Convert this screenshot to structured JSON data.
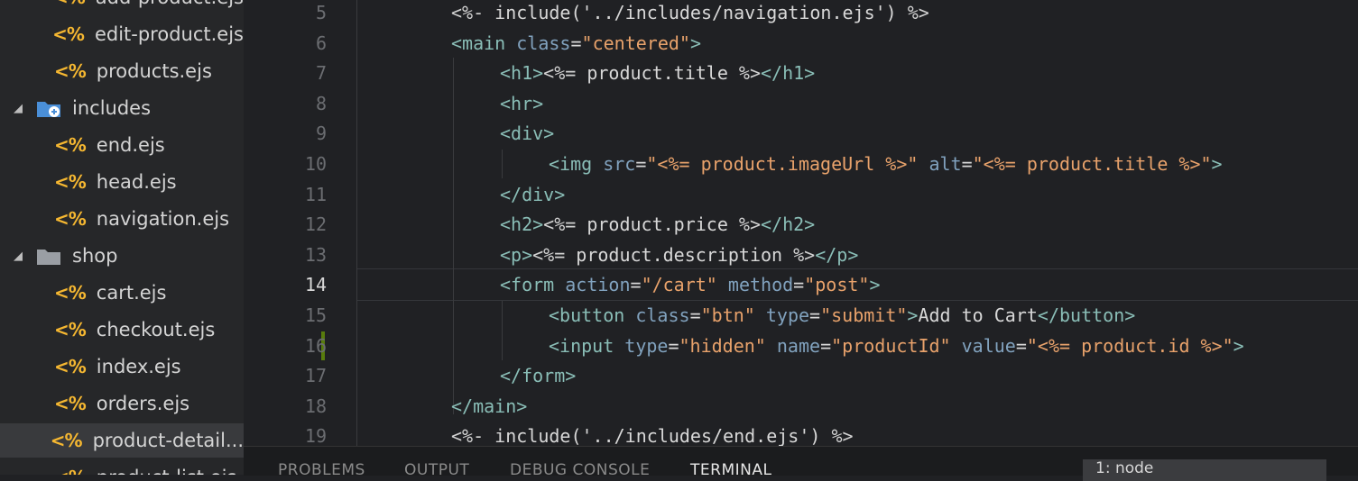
{
  "sidebar": {
    "items": [
      {
        "label": "add-product.ejs",
        "kind": "ejs",
        "indent": 2
      },
      {
        "label": "edit-product.ejs",
        "kind": "ejs",
        "indent": 2
      },
      {
        "label": "products.ejs",
        "kind": "ejs",
        "indent": 2
      },
      {
        "label": "includes",
        "kind": "folder-special",
        "indent": 1
      },
      {
        "label": "end.ejs",
        "kind": "ejs",
        "indent": 2
      },
      {
        "label": "head.ejs",
        "kind": "ejs",
        "indent": 2
      },
      {
        "label": "navigation.ejs",
        "kind": "ejs",
        "indent": 2
      },
      {
        "label": "shop",
        "kind": "folder",
        "indent": 1
      },
      {
        "label": "cart.ejs",
        "kind": "ejs",
        "indent": 2
      },
      {
        "label": "checkout.ejs",
        "kind": "ejs",
        "indent": 2
      },
      {
        "label": "index.ejs",
        "kind": "ejs",
        "indent": 2
      },
      {
        "label": "orders.ejs",
        "kind": "ejs",
        "indent": 2
      },
      {
        "label": "product-detail...",
        "kind": "ejs",
        "indent": 2,
        "selected": true
      },
      {
        "label": "product-list.ejs",
        "kind": "ejs",
        "indent": 2
      }
    ],
    "ejs_glyph": "<%"
  },
  "editor": {
    "active_line": 14,
    "lines": [
      {
        "n": 5,
        "indent": 0,
        "tokens": [
          [
            "del",
            "<%- "
          ],
          [
            "plain",
            "include('../includes/navigation.ejs') "
          ],
          [
            "del",
            "%>"
          ]
        ]
      },
      {
        "n": 6,
        "indent": 0,
        "tokens": [
          [
            "tag",
            "<main"
          ],
          [
            "plain",
            " "
          ],
          [
            "attr",
            "class"
          ],
          [
            "plain",
            "="
          ],
          [
            "str",
            "\"centered\""
          ],
          [
            "tag",
            ">"
          ]
        ]
      },
      {
        "n": 7,
        "indent": 1,
        "tokens": [
          [
            "tag",
            "<h1>"
          ],
          [
            "del",
            "<%= "
          ],
          [
            "plain",
            "product.title "
          ],
          [
            "del",
            "%>"
          ],
          [
            "tag",
            "</h1>"
          ]
        ]
      },
      {
        "n": 8,
        "indent": 1,
        "tokens": [
          [
            "tag",
            "<hr>"
          ]
        ]
      },
      {
        "n": 9,
        "indent": 1,
        "tokens": [
          [
            "tag",
            "<div>"
          ]
        ]
      },
      {
        "n": 10,
        "indent": 2,
        "tokens": [
          [
            "tag",
            "<img"
          ],
          [
            "plain",
            " "
          ],
          [
            "attr",
            "src"
          ],
          [
            "plain",
            "="
          ],
          [
            "str",
            "\"<%= product.imageUrl %>\""
          ],
          [
            "plain",
            " "
          ],
          [
            "attr",
            "alt"
          ],
          [
            "plain",
            "="
          ],
          [
            "str",
            "\"<%= product.title %>\""
          ],
          [
            "tag",
            ">"
          ]
        ]
      },
      {
        "n": 11,
        "indent": 1,
        "tokens": [
          [
            "tag",
            "</div>"
          ]
        ]
      },
      {
        "n": 12,
        "indent": 1,
        "tokens": [
          [
            "tag",
            "<h2>"
          ],
          [
            "del",
            "<%= "
          ],
          [
            "plain",
            "product.price "
          ],
          [
            "del",
            "%>"
          ],
          [
            "tag",
            "</h2>"
          ]
        ]
      },
      {
        "n": 13,
        "indent": 1,
        "tokens": [
          [
            "tag",
            "<p>"
          ],
          [
            "del",
            "<%= "
          ],
          [
            "plain",
            "product.description "
          ],
          [
            "del",
            "%>"
          ],
          [
            "tag",
            "</p>"
          ]
        ]
      },
      {
        "n": 14,
        "indent": 1,
        "tokens": [
          [
            "tag",
            "<form"
          ],
          [
            "plain",
            " "
          ],
          [
            "attr",
            "action"
          ],
          [
            "plain",
            "="
          ],
          [
            "str",
            "\"/cart\""
          ],
          [
            "plain",
            " "
          ],
          [
            "attr",
            "method"
          ],
          [
            "plain",
            "="
          ],
          [
            "str",
            "\"post\""
          ],
          [
            "tag",
            ">"
          ]
        ]
      },
      {
        "n": 15,
        "indent": 2,
        "tokens": [
          [
            "tag",
            "<button"
          ],
          [
            "plain",
            " "
          ],
          [
            "attr",
            "class"
          ],
          [
            "plain",
            "="
          ],
          [
            "str",
            "\"btn\""
          ],
          [
            "plain",
            " "
          ],
          [
            "attr",
            "type"
          ],
          [
            "plain",
            "="
          ],
          [
            "str",
            "\"submit\""
          ],
          [
            "tag",
            ">"
          ],
          [
            "plain",
            "Add to Cart"
          ],
          [
            "tag",
            "</button>"
          ]
        ]
      },
      {
        "n": 16,
        "indent": 2,
        "tokens": [
          [
            "tag",
            "<input"
          ],
          [
            "plain",
            " "
          ],
          [
            "attr",
            "type"
          ],
          [
            "plain",
            "="
          ],
          [
            "str",
            "\"hidden\""
          ],
          [
            "plain",
            " "
          ],
          [
            "attr",
            "name"
          ],
          [
            "plain",
            "="
          ],
          [
            "str",
            "\"productId\""
          ],
          [
            "plain",
            " "
          ],
          [
            "attr",
            "value"
          ],
          [
            "plain",
            "="
          ],
          [
            "str",
            "\"<%= product.id %>\""
          ],
          [
            "tag",
            ">"
          ]
        ]
      },
      {
        "n": 17,
        "indent": 1,
        "tokens": [
          [
            "tag",
            "</form>"
          ]
        ]
      },
      {
        "n": 18,
        "indent": 0,
        "tokens": [
          [
            "tag",
            "</main>"
          ]
        ]
      },
      {
        "n": 19,
        "indent": 0,
        "tokens": [
          [
            "del",
            "<%- "
          ],
          [
            "plain",
            "include('../includes/end.ejs') "
          ],
          [
            "del",
            "%>"
          ]
        ]
      }
    ],
    "colors": {
      "tag": "#8abeb7",
      "attr": "#81a2be",
      "str": "#e8a26b",
      "del": "#d2d2d2",
      "plain": "#d8d8d8"
    }
  },
  "panel": {
    "tabs": [
      "PROBLEMS",
      "OUTPUT",
      "DEBUG CONSOLE",
      "TERMINAL"
    ],
    "active_tab": "TERMINAL",
    "terminal_select": "1: node"
  }
}
